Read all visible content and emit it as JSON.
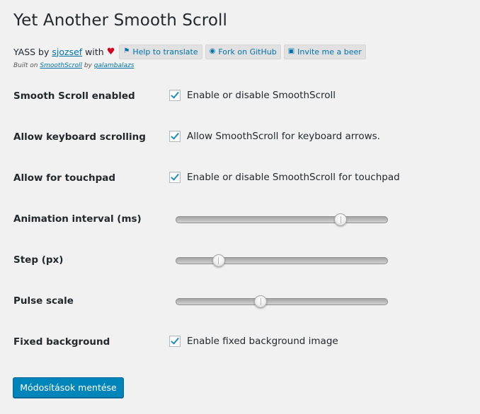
{
  "title": "Yet Another Smooth Scroll",
  "meta": {
    "prefix": "YASS by",
    "author": "sjozsef",
    "with": "with",
    "heart_color": "#d9001b",
    "buttons": [
      {
        "label": "Help to translate",
        "icon": "flag-icon"
      },
      {
        "label": "Fork on GitHub",
        "icon": "github-icon"
      },
      {
        "label": "Invite me a beer",
        "icon": "beer-icon"
      }
    ]
  },
  "built": {
    "prefix": "Built on",
    "lib": "SmoothScroll",
    "by": "by",
    "author": "galambalazs"
  },
  "settings": {
    "smooth_scroll": {
      "label": "Smooth Scroll enabled",
      "checked": true,
      "description": "Enable or disable SmoothScroll"
    },
    "keyboard": {
      "label": "Allow keyboard scrolling",
      "checked": true,
      "description": "Allow SmoothScroll for keyboard arrows."
    },
    "touchpad": {
      "label": "Allow for touchpad",
      "checked": true,
      "description": "Enable or disable SmoothScroll for touchpad"
    },
    "animation_interval": {
      "label": "Animation interval (ms)",
      "slider_fraction": 0.78
    },
    "step": {
      "label": "Step (px)",
      "slider_fraction": 0.2
    },
    "pulse_scale": {
      "label": "Pulse scale",
      "slider_fraction": 0.4
    },
    "fixed_background": {
      "label": "Fixed background",
      "checked": true,
      "description": "Enable fixed background image"
    }
  },
  "save_label": "Módosítások mentése",
  "accent_color": "#0085ba"
}
